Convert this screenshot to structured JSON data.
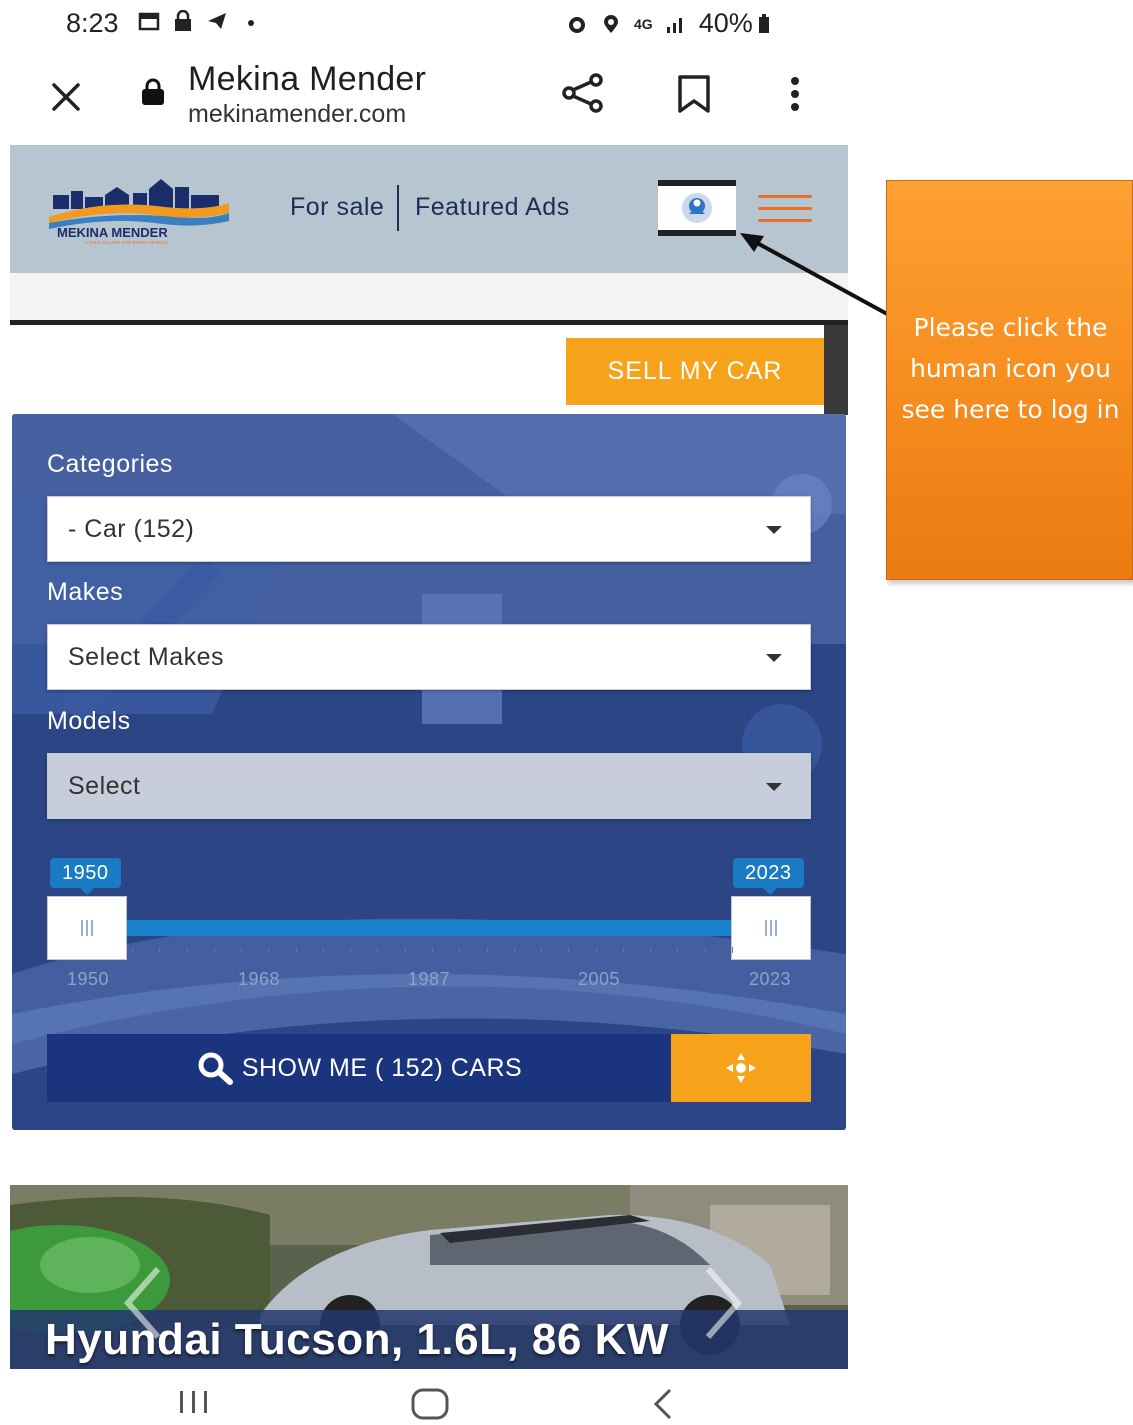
{
  "status_bar": {
    "time": "8:23",
    "network": "4G",
    "battery": "40%"
  },
  "browser": {
    "title": "Mekina Mender",
    "url": "mekinamender.com"
  },
  "site": {
    "logo_text": "MEKINA MENDER",
    "logo_tagline": "A SALE VILLAGE FOR EVERY VEHICLE",
    "nav": {
      "for_sale": "For sale",
      "featured_ads": "Featured Ads"
    },
    "sell_button": "SELL MY CAR"
  },
  "search": {
    "categories_label": "Categories",
    "categories_value": "- Car (152)",
    "makes_label": "Makes",
    "makes_placeholder": "Select Makes",
    "models_label": "Models",
    "models_placeholder": "Select",
    "year_range": {
      "min": 1950,
      "max": 2023,
      "selected_min": "1950",
      "selected_max": "2023",
      "scale_labels": [
        "1950",
        "1968",
        "1987",
        "2005",
        "2023"
      ]
    },
    "show_button": "SHOW ME ( 152) CARS"
  },
  "listing": {
    "title": "Hyundai Tucson, 1.6L, 86 KW"
  },
  "annotation": {
    "text": "Please click the human icon you see here to log in"
  },
  "colors": {
    "header_bg": "#b7c5d1",
    "panel_bg": "#2a4482",
    "accent_orange": "#f7a21b",
    "slider_blue": "#1980cc",
    "callout_orange": "#f58a1c"
  }
}
